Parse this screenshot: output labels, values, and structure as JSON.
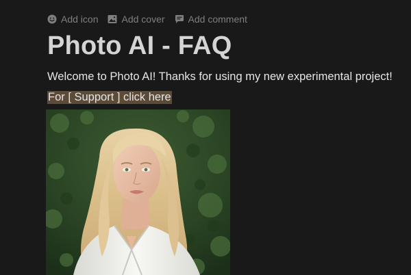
{
  "page_controls": {
    "add_icon": {
      "label": "Add icon",
      "icon": "smiley-icon"
    },
    "add_cover": {
      "label": "Add cover",
      "icon": "image-icon"
    },
    "add_comment": {
      "label": "Add comment",
      "icon": "comment-icon"
    }
  },
  "title": "Photo AI - FAQ",
  "welcome_text": "Welcome to Photo AI! Thanks for using my new experimental project!",
  "support_link": "For [ Support ] click here",
  "photo": {
    "alt": "",
    "subject": "portrait-photo"
  },
  "colors": {
    "background": "#191919",
    "title": "#d4d4d4",
    "text": "#e6e6e6",
    "muted": "#7f7f7f",
    "highlight": "#5c4b37"
  }
}
